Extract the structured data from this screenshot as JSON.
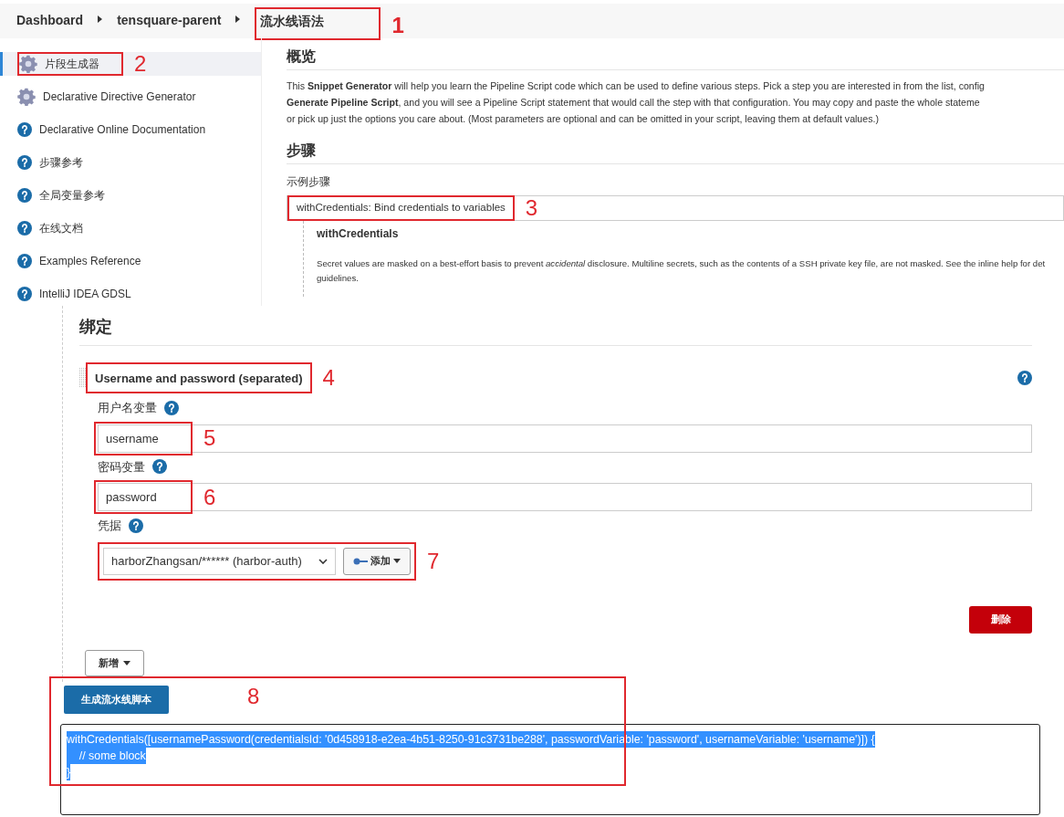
{
  "breadcrumb": [
    {
      "label": "Dashboard"
    },
    {
      "label": "tensquare-parent"
    },
    {
      "label": "流水线语法",
      "annotation": "1"
    }
  ],
  "sidebar": {
    "items": [
      {
        "label": "片段生成器",
        "kind": "gear",
        "selected": true,
        "annotation": "2"
      },
      {
        "label": "Declarative Directive Generator",
        "kind": "gear",
        "selected": false
      },
      {
        "label": "Declarative Online Documentation",
        "kind": "help",
        "selected": false
      },
      {
        "label": "步骤参考",
        "kind": "help",
        "selected": false
      },
      {
        "label": "全局变量参考",
        "kind": "help",
        "selected": false
      },
      {
        "label": "在线文档",
        "kind": "help",
        "selected": false
      },
      {
        "label": "Examples Reference",
        "kind": "help",
        "selected": false
      },
      {
        "label": "IntelliJ IDEA GDSL",
        "kind": "help",
        "selected": false
      }
    ]
  },
  "overview": {
    "title": "概览",
    "lines": [
      "This **Snippet Generator** will help you learn the Pipeline Script code which can be used to define various steps. Pick a step you are interested in from the list, config",
      "**Generate Pipeline Script**, and you will see a Pipeline Script statement that would call the step with that configuration. You may copy and paste the whole stateme",
      "or pick up just the options you care about. (Most parameters are optional and can be omitted in your script, leaving them at default values.)"
    ]
  },
  "steps": {
    "title": "步骤",
    "label": "示例步骤",
    "value": "withCredentials: Bind credentials to variables",
    "annotation": "3",
    "help_title": "withCredentials",
    "help_lines": [
      "Secret values are masked on a best-effort basis to prevent *accidental* disclosure. Multiline secrets, such as the contents of a SSH private key file, are not masked. See the inline help for det",
      "guidelines."
    ]
  },
  "bindings": {
    "title": "绑定",
    "binding": {
      "title": "Username and password (separated)",
      "annotation": "4",
      "fields": [
        {
          "kind": "text",
          "label": "用户名变量",
          "value": "username",
          "annotation": "5"
        },
        {
          "kind": "text",
          "label": "密码变量",
          "value": "password",
          "annotation": "6"
        },
        {
          "kind": "select",
          "label": "凭据",
          "value": "harborZhangsan/****** (harbor-auth)",
          "add_button": "添加",
          "annotation": "7"
        }
      ],
      "delete_button": "删除"
    },
    "add_button": "新增"
  },
  "generate": {
    "button": "生成流水线脚本",
    "annotation": "8",
    "selected": true,
    "code": [
      "withCredentials([usernamePassword(credentialsId: '0d458918-e2ea-4b51-8250-91c3731be288', passwordVariable: 'password', usernameVariable: 'username')]) {",
      "    // some block",
      "}"
    ]
  }
}
